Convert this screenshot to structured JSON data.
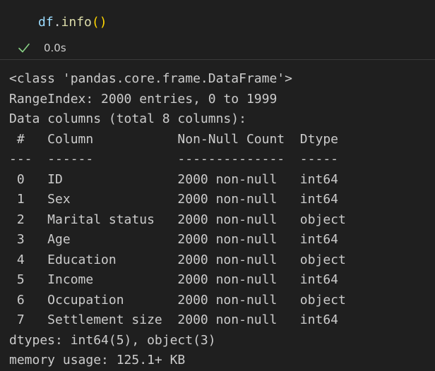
{
  "code": {
    "var": "df",
    "dot": ".",
    "fn": "info",
    "paren_open": "(",
    "paren_close": ")"
  },
  "execution": {
    "status": "success",
    "time": "0.0s"
  },
  "output": {
    "lines": [
      "<class 'pandas.core.frame.DataFrame'>",
      "RangeIndex: 2000 entries, 0 to 1999",
      "Data columns (total 8 columns):",
      " #   Column           Non-Null Count  Dtype ",
      "---  ------           --------------  ----- ",
      " 0   ID               2000 non-null   int64 ",
      " 1   Sex              2000 non-null   int64 ",
      " 2   Marital status   2000 non-null   object",
      " 3   Age              2000 non-null   int64 ",
      " 4   Education        2000 non-null   object",
      " 5   Income           2000 non-null   int64 ",
      " 6   Occupation       2000 non-null   object",
      " 7   Settlement size  2000 non-null   int64 ",
      "dtypes: int64(5), object(3)",
      "memory usage: 125.1+ KB"
    ]
  },
  "colors": {
    "background": "#1f1f1f",
    "success": "#89d185",
    "text": "#cccccc"
  }
}
